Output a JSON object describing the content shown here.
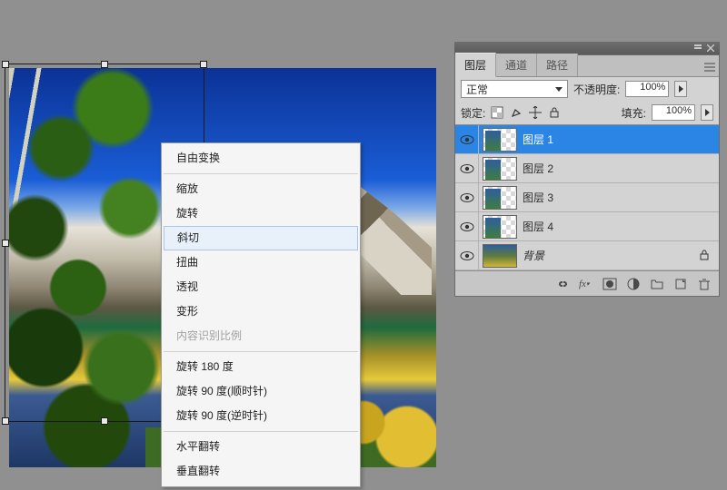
{
  "context_menu": {
    "items": [
      {
        "label": "自由变换",
        "sep_after": true
      },
      {
        "label": "缩放"
      },
      {
        "label": "旋转"
      },
      {
        "label": "斜切",
        "highlight": true
      },
      {
        "label": "扭曲"
      },
      {
        "label": "透视"
      },
      {
        "label": "变形"
      },
      {
        "label": "内容识别比例",
        "disabled": true,
        "sep_after": true
      },
      {
        "label": "旋转 180 度"
      },
      {
        "label": "旋转 90 度(顺时针)"
      },
      {
        "label": "旋转 90 度(逆时针)",
        "sep_after": true
      },
      {
        "label": "水平翻转"
      },
      {
        "label": "垂直翻转"
      }
    ]
  },
  "panel": {
    "tabs": [
      "图层",
      "通道",
      "路径"
    ],
    "active_tab": 0,
    "blend_mode_label": "正常",
    "opacity_label": "不透明度:",
    "opacity_value": "100%",
    "lock_label": "锁定:",
    "fill_label": "填充:",
    "fill_value": "100%",
    "layers": [
      {
        "name": "图层 1",
        "visible": true,
        "selected": true,
        "type": "normal"
      },
      {
        "name": "图层 2",
        "visible": true,
        "selected": false,
        "type": "normal"
      },
      {
        "name": "图层 3",
        "visible": true,
        "selected": false,
        "type": "normal"
      },
      {
        "name": "图层 4",
        "visible": true,
        "selected": false,
        "type": "normal"
      },
      {
        "name": "背景",
        "visible": true,
        "selected": false,
        "type": "background",
        "locked": true
      }
    ],
    "footer_icons": [
      "link",
      "fx",
      "mask",
      "adjustment",
      "group",
      "new",
      "trash"
    ]
  }
}
